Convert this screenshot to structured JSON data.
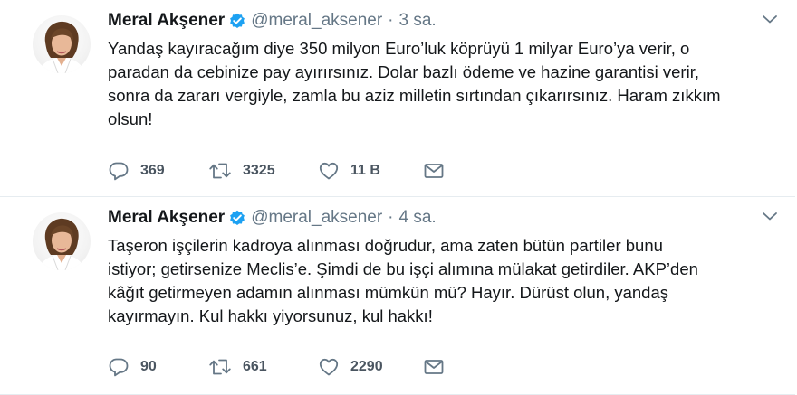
{
  "tweets": [
    {
      "name": "Meral Akşener",
      "handle": "@meral_aksener",
      "separator": "·",
      "time": "3 sa.",
      "text_lines": [
        "Yandaş kayıracağım diye 350 milyon Euro’luk köprüyü 1 milyar Euro’ya verir, o",
        "paradan da cebinize pay ayırırsınız. Dolar bazlı ödeme ve hazine garantisi verir,",
        "sonra da zararı vergiyle, zamla bu aziz milletin sırtından çıkarırsınız. Haram zıkkım",
        "olsun!"
      ],
      "replies": "369",
      "retweets": "3325",
      "likes": "11 B"
    },
    {
      "name": "Meral Akşener",
      "handle": "@meral_aksener",
      "separator": "·",
      "time": "4 sa.",
      "text_lines": [
        "Taşeron işçilerin kadroya alınması doğrudur, ama zaten bütün partiler bunu",
        "istiyor; getirsenize Meclis’e. Şimdi de bu işçi alımına mülakat getirdiler. AKP’den",
        "kâğıt getirmeyen adamın alınması mümkün mü? Hayır. Dürüst olun, yandaş",
        "kayırmayın. Kul hakkı yiyorsunuz, kul hakkı!"
      ],
      "replies": "90",
      "retweets": "661",
      "likes": "2290"
    }
  ],
  "icons": {
    "verified": "verified-badge-icon",
    "caret": "chevron-down-icon",
    "reply": "reply-icon",
    "retweet": "retweet-icon",
    "like": "heart-icon",
    "dm": "envelope-icon"
  },
  "colors": {
    "verified": "#1da1f2",
    "secondary_text": "#657786",
    "primary_text": "#14171a",
    "divider": "#e6ecf0"
  }
}
